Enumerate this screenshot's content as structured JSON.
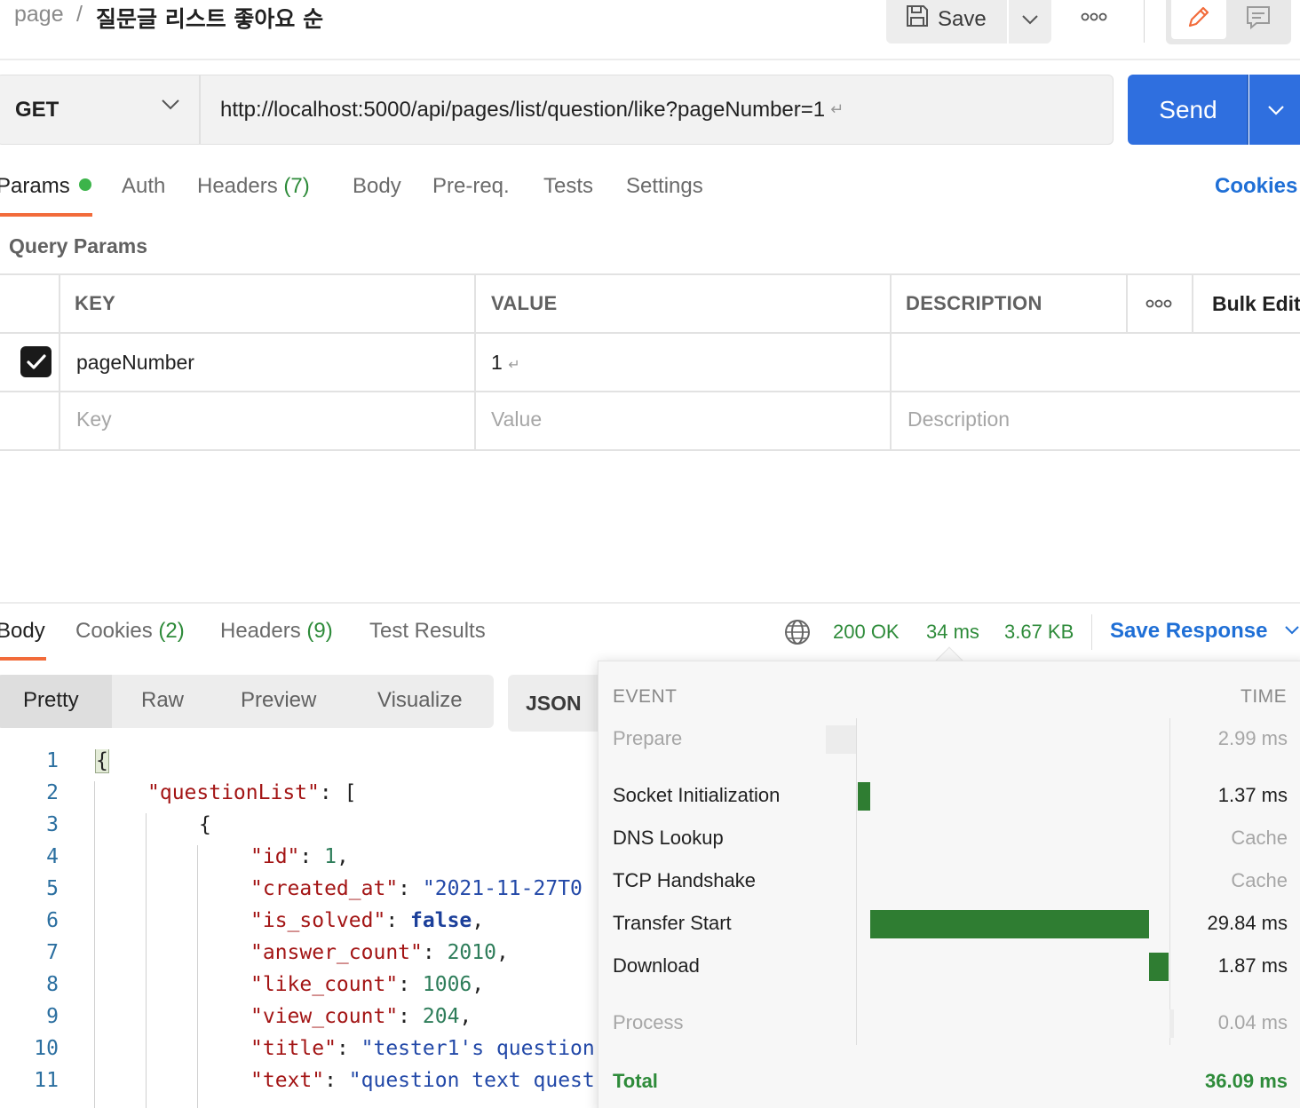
{
  "header": {
    "breadcrumb_root": "page",
    "breadcrumb_sep": "/",
    "request_name": "질문글 리스트 좋아요 순",
    "save_label": "Save"
  },
  "request": {
    "method": "GET",
    "url": "http://localhost:5000/api/pages/list/question/like?pageNumber=1",
    "url_return_glyph": "↵",
    "send_label": "Send"
  },
  "request_tabs": {
    "params": "Params",
    "auth": "Auth",
    "headers": "Headers",
    "headers_count": "(7)",
    "body": "Body",
    "prereq": "Pre-req.",
    "tests": "Tests",
    "settings": "Settings",
    "cookies": "Cookies"
  },
  "query_params": {
    "title": "Query Params",
    "columns": {
      "key": "KEY",
      "value": "VALUE",
      "description": "DESCRIPTION",
      "bulk_edit": "Bulk Edit"
    },
    "rows": [
      {
        "checked": true,
        "key": "pageNumber",
        "value": "1",
        "value_return_glyph": "↵",
        "description": ""
      }
    ],
    "placeholders": {
      "key": "Key",
      "value": "Value",
      "description": "Description"
    }
  },
  "response_tabs": {
    "body": "Body",
    "cookies": "Cookies",
    "cookies_count": "(2)",
    "headers": "Headers",
    "headers_count": "(9)",
    "test_results": "Test Results"
  },
  "response_status": {
    "status": "200 OK",
    "time": "34 ms",
    "size": "3.67 KB",
    "save_response": "Save Response"
  },
  "view_options": {
    "pretty": "Pretty",
    "raw": "Raw",
    "preview": "Preview",
    "visualize": "Visualize",
    "format": "JSON"
  },
  "code_lines": [
    {
      "n": "1",
      "text": "{"
    },
    {
      "n": "2",
      "key": "\"questionList\"",
      "rest": ": ["
    },
    {
      "n": "3",
      "text": "{"
    },
    {
      "n": "4",
      "key": "\"id\"",
      "colon": ": ",
      "num": "1",
      "end": ","
    },
    {
      "n": "5",
      "key": "\"created_at\"",
      "colon": ": ",
      "str": "\"2021-11-27T0"
    },
    {
      "n": "6",
      "key": "\"is_solved\"",
      "colon": ": ",
      "bool": "false",
      "end": ","
    },
    {
      "n": "7",
      "key": "\"answer_count\"",
      "colon": ": ",
      "num": "2010",
      "end": ","
    },
    {
      "n": "8",
      "key": "\"like_count\"",
      "colon": ": ",
      "num": "1006",
      "end": ","
    },
    {
      "n": "9",
      "key": "\"view_count\"",
      "colon": ": ",
      "num": "204",
      "end": ","
    },
    {
      "n": "10",
      "key": "\"title\"",
      "colon": ": ",
      "str": "\"tester1's question"
    },
    {
      "n": "11",
      "key": "\"text\"",
      "colon": ": ",
      "str": "\"question text quest"
    }
  ],
  "timing": {
    "event_header": "EVENT",
    "time_header": "TIME",
    "events": [
      {
        "name": "Prepare",
        "time": "2.99 ms",
        "muted": true
      },
      {
        "name": "Socket Initialization",
        "time": "1.37 ms",
        "muted": false
      },
      {
        "name": "DNS Lookup",
        "time": "Cache",
        "muted": false
      },
      {
        "name": "TCP Handshake",
        "time": "Cache",
        "muted": false
      },
      {
        "name": "Transfer Start",
        "time": "29.84 ms",
        "muted": false
      },
      {
        "name": "Download",
        "time": "1.87 ms",
        "muted": false
      },
      {
        "name": "Process",
        "time": "0.04 ms",
        "muted": true
      }
    ],
    "total_label": "Total",
    "total_time": "36.09 ms",
    "bar_color": "#2f7d32"
  },
  "colors": {
    "accent_orange": "#f26b3a",
    "send_blue": "#2f6fdf",
    "link_blue": "#1f6fd6",
    "success_green": "#2e8b3a"
  }
}
